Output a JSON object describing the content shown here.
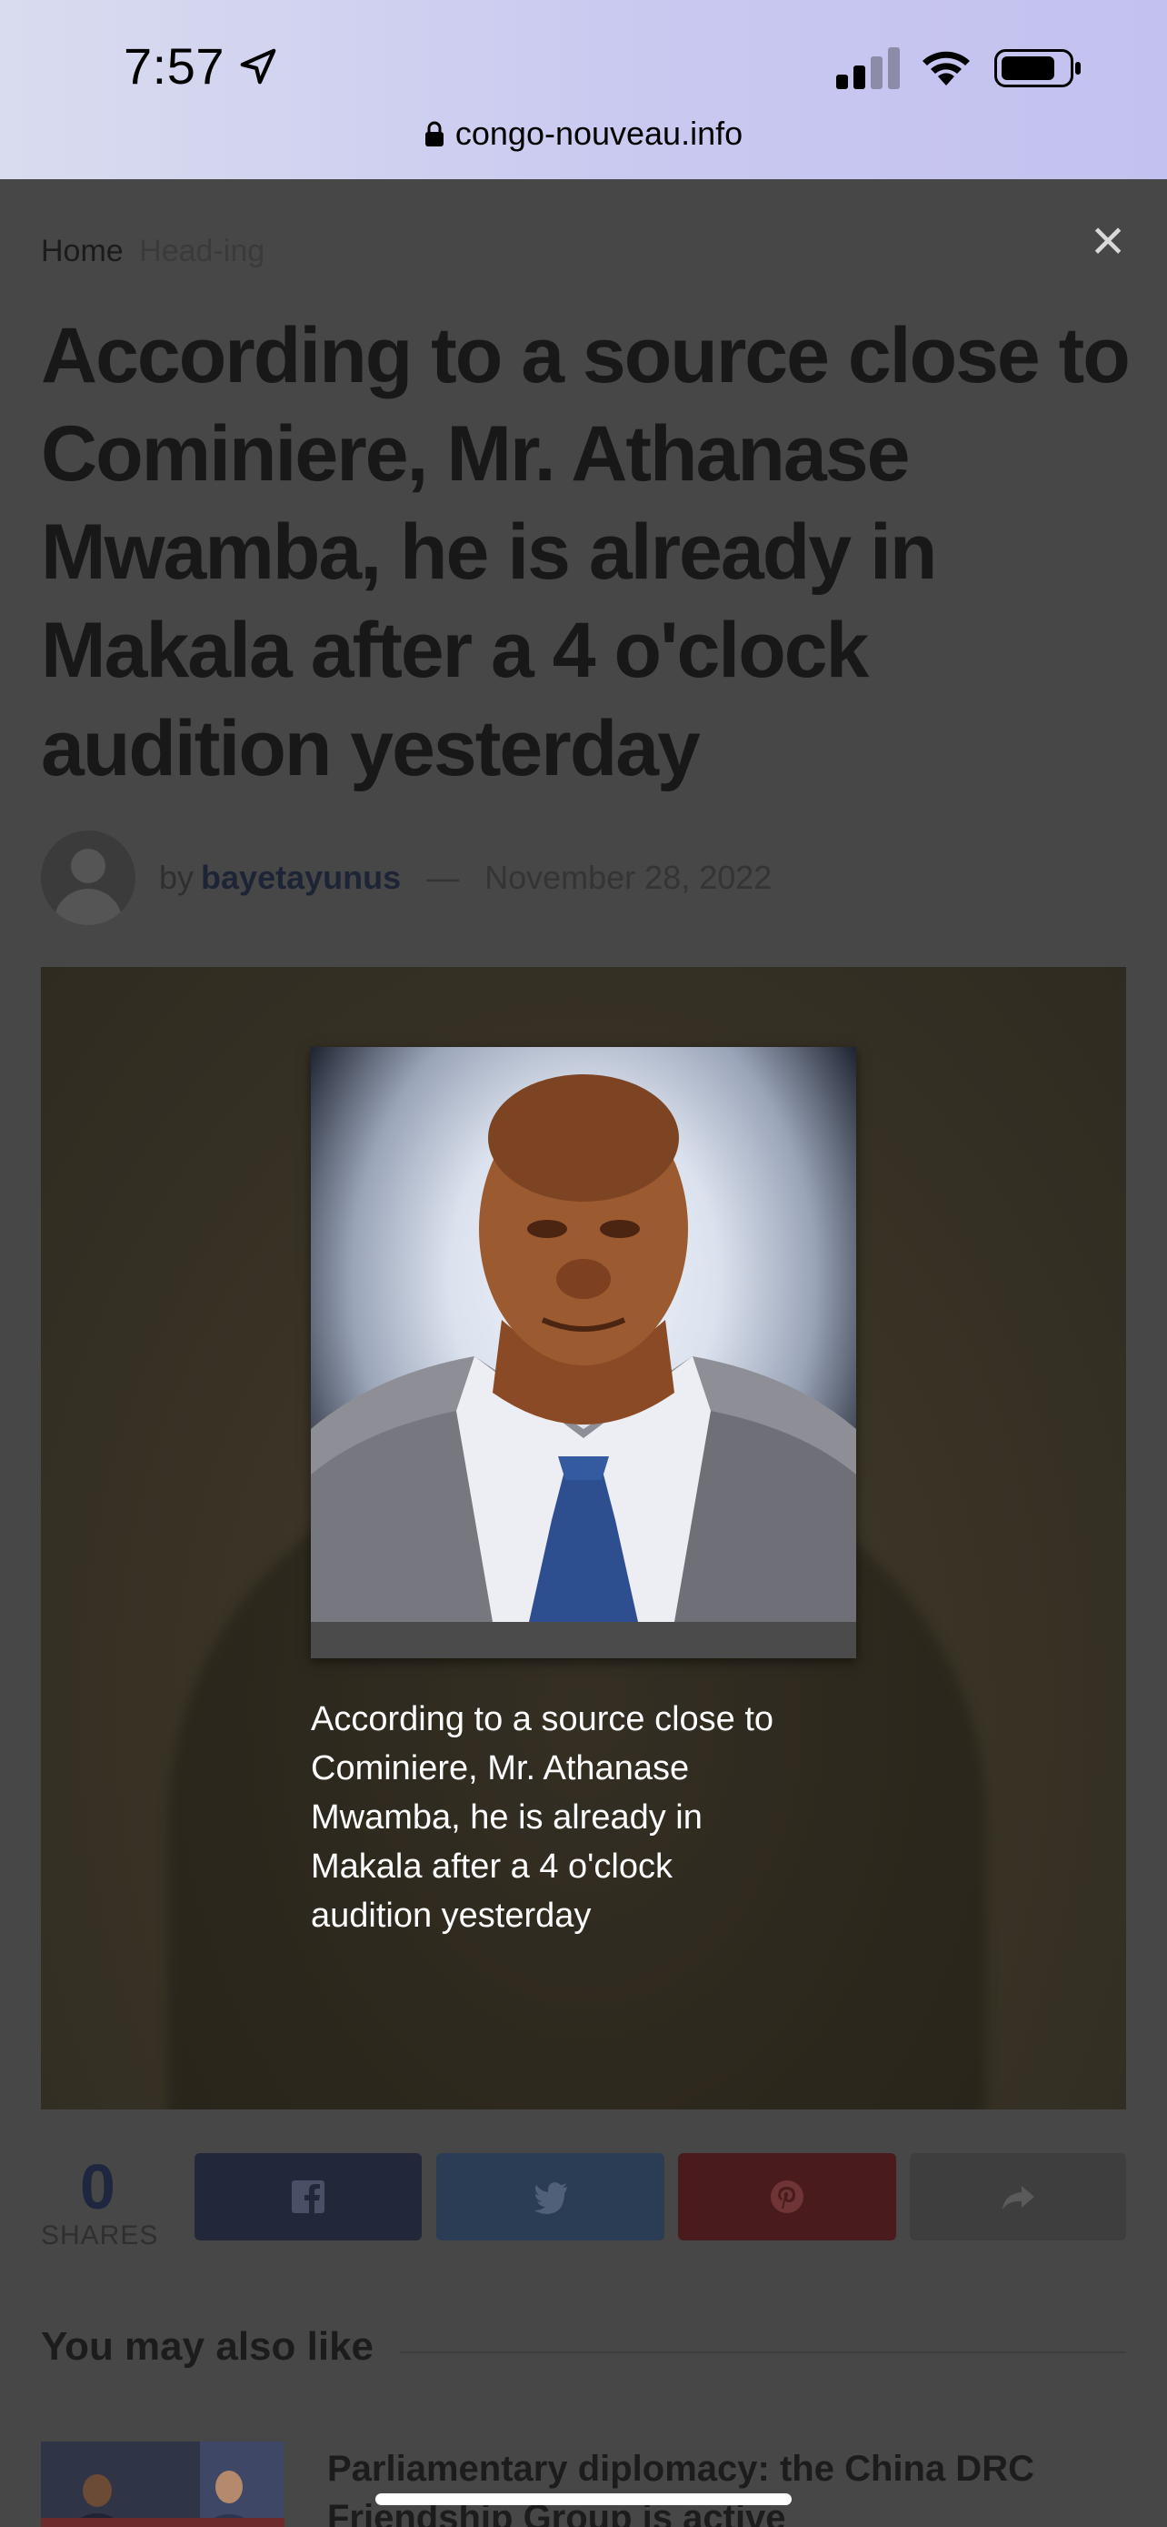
{
  "status_bar": {
    "time": "7:57",
    "url": "congo-nouveau.info"
  },
  "article": {
    "breadcrumb_home": "Home",
    "breadcrumb_current": "Head-ing",
    "headline": "According to a source close to Cominiere, Mr. Athanase Mwamba, he is already in Makala after a 4 o'clock audition yesterday",
    "by_label": "by",
    "author": "bayetayunus",
    "dash": "—",
    "date": "November 28, 2022",
    "caption": "According to a source close to Cominiere, Mr. Athanase Mwamba, he is already in Makala after a 4 o'clock audition yesterday"
  },
  "share_bar": {
    "count": "0",
    "count_label": "SHARES",
    "buttons": [
      "facebook-icon",
      "twitter-icon",
      "pinterest-icon",
      "share-icon"
    ],
    "colors": {
      "facebook": "#23273a",
      "twitter": "#2b3d55",
      "pinterest": "#4a1b1d",
      "share": "#3e3e3e"
    }
  },
  "related": {
    "heading": "You may also like",
    "items": [
      {
        "title": "Parliamentary diplomacy: the China DRC Friendship Group is active"
      }
    ]
  },
  "close_icon": "close-icon"
}
